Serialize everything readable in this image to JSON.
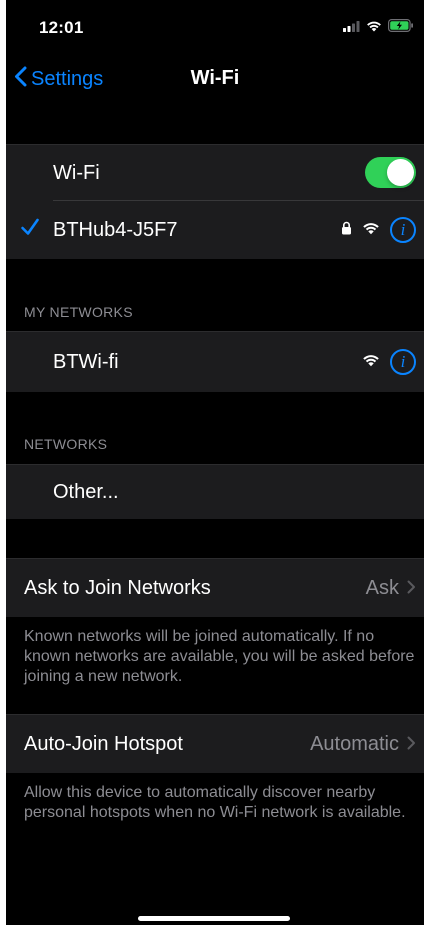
{
  "status_bar": {
    "time": "12:01"
  },
  "nav": {
    "back_label": "Settings",
    "title": "Wi-Fi"
  },
  "wifi": {
    "toggle_label": "Wi-Fi",
    "toggle_on": true,
    "connected_network": "BTHub4-J5F7",
    "info_glyph": "i"
  },
  "my_networks": {
    "header": "MY NETWORKS",
    "items": [
      {
        "name": "BTWi-fi",
        "info_glyph": "i"
      }
    ]
  },
  "networks": {
    "header": "NETWORKS",
    "other_label": "Other..."
  },
  "ask_to_join": {
    "label": "Ask to Join Networks",
    "value": "Ask",
    "footnote": "Known networks will be joined automatically. If no known networks are available, you will be asked before joining a new network."
  },
  "auto_join": {
    "label": "Auto-Join Hotspot",
    "value": "Automatic",
    "footnote": "Allow this device to automatically discover nearby personal hotspots when no Wi-Fi network is available."
  },
  "colors": {
    "accent": "#0a84ff",
    "toggle_on": "#30d158",
    "battery_charging": "#30d158",
    "cell_background": "#1c1c1e",
    "background": "#000000",
    "secondary_text": "#8d8d93"
  }
}
